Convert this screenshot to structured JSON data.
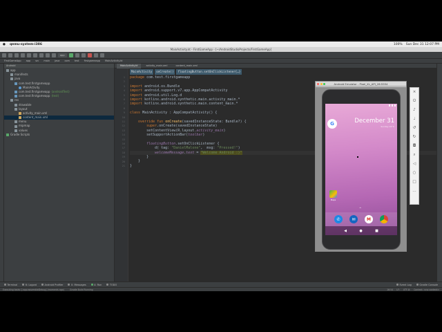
{
  "mac_menubar": {
    "app_name": "qemu-system-i386",
    "status_items": [
      "100%",
      "Sun Dec 31 12:07 PM"
    ]
  },
  "window_title": "MainActivity.kt - FirstGameApp - [~/AndroidStudioProjects/FirstGameApp]",
  "toolbar": {
    "run_config": "app"
  },
  "breadcrumb": [
    "FirstGameApp",
    "app",
    "src",
    "main",
    "java",
    "com",
    "test",
    "firstgameapp",
    "MainActivity.kt"
  ],
  "project_panel": {
    "view_mode": "Android",
    "tree": [
      {
        "label": "app",
        "icon": "folder-icon",
        "indent": 0,
        "extra": ""
      },
      {
        "label": "manifests",
        "icon": "folder-icon",
        "indent": 1,
        "extra": ""
      },
      {
        "label": "java",
        "icon": "folder-icon",
        "indent": 1,
        "extra": ""
      },
      {
        "label": "com.test.firstgameapp",
        "icon": "package-icon",
        "indent": 2,
        "extra": ""
      },
      {
        "label": "MainActivity",
        "icon": "class-icon",
        "indent": 3,
        "extra": ""
      },
      {
        "label": "com.test.firstgameapp",
        "icon": "package-icon",
        "indent": 2,
        "extra": "(androidTest)"
      },
      {
        "label": "com.test.firstgameapp",
        "icon": "package-icon",
        "indent": 2,
        "extra": "(test)"
      },
      {
        "label": "res",
        "icon": "folder-icon",
        "indent": 1,
        "extra": ""
      },
      {
        "label": "drawable",
        "icon": "folder-icon",
        "indent": 2,
        "extra": ""
      },
      {
        "label": "layout",
        "icon": "folder-icon",
        "indent": 2,
        "extra": ""
      },
      {
        "label": "activity_main.xml",
        "icon": "file-icon",
        "indent": 3,
        "extra": ""
      },
      {
        "label": "content_main.xml",
        "icon": "file-icon",
        "indent": 3,
        "extra": ""
      },
      {
        "label": "menu",
        "icon": "folder-icon",
        "indent": 2,
        "extra": ""
      },
      {
        "label": "mipmap",
        "icon": "folder-icon",
        "indent": 2,
        "extra": ""
      },
      {
        "label": "values",
        "icon": "folder-icon",
        "indent": 2,
        "extra": ""
      },
      {
        "label": "Gradle Scripts",
        "icon": "gradle-icon",
        "indent": 0,
        "extra": ""
      }
    ]
  },
  "editor": {
    "tabs": [
      {
        "label": "MainActivity.kt",
        "active": true
      },
      {
        "label": "activity_main.xml",
        "active": false
      },
      {
        "label": "content_main.xml",
        "active": false
      }
    ],
    "code_crumbs": [
      "MainActivity",
      "onCreate()",
      "floatingButton.setOnClickListener{…}"
    ]
  },
  "bottom_tools": {
    "left": [
      "Terminal",
      "6: Logcat",
      "Android Profiler",
      "0: Messages",
      "4: Run",
      "TODO"
    ],
    "right": [
      "Event Log",
      "Gradle Console"
    ]
  },
  "status_bar": {
    "message": "Executing tasks: [:app:assembleDebug] (moments ago)",
    "gradle": "Gradle Build Running",
    "right": [
      "16:54",
      "LF:",
      "UTF-8:",
      "Context: <no context>"
    ]
  },
  "emulator": {
    "title": "Android Emulator - Pixel_XL_API_26:5554",
    "date": "December 31",
    "date_sub": "Sunday 22°C",
    "maps_label": "Maps"
  }
}
